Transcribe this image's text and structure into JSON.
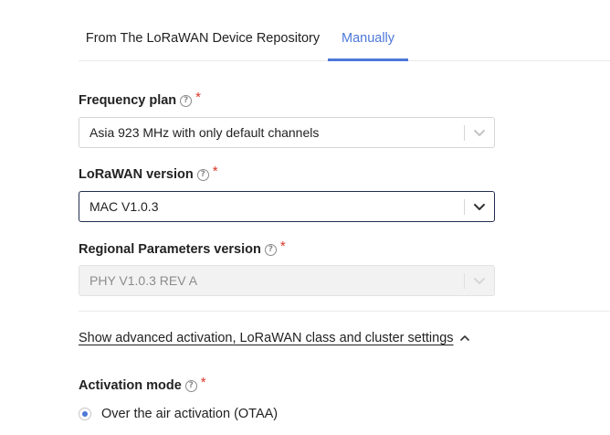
{
  "tabs": {
    "repository_label": "From The LoRaWAN Device Repository",
    "manual_label": "Manually",
    "active": "Manually"
  },
  "frequency_plan": {
    "label": "Frequency plan",
    "help_icon": "question-circle-icon",
    "required_mark": "*",
    "value": "Asia 923 MHz with only default channels"
  },
  "lorawan_version": {
    "label": "LoRaWAN version",
    "help_icon": "question-circle-icon",
    "required_mark": "*",
    "value": "MAC V1.0.3"
  },
  "regional_parameters": {
    "label": "Regional Parameters version",
    "help_icon": "question-circle-icon",
    "required_mark": "*",
    "value": "PHY V1.0.3 REV A",
    "disabled": true
  },
  "advanced": {
    "link_label": "Show advanced activation, LoRaWAN class and cluster settings",
    "icon": "chevron-up-icon"
  },
  "activation_mode": {
    "label": "Activation mode",
    "help_icon": "question-circle-icon",
    "required_mark": "*",
    "options": [
      {
        "label": "Over the air activation (OTAA)",
        "selected": true
      }
    ]
  },
  "colors": {
    "accent": "#4c78d8",
    "required": "#d9372b",
    "focus_border": "#222e50"
  }
}
